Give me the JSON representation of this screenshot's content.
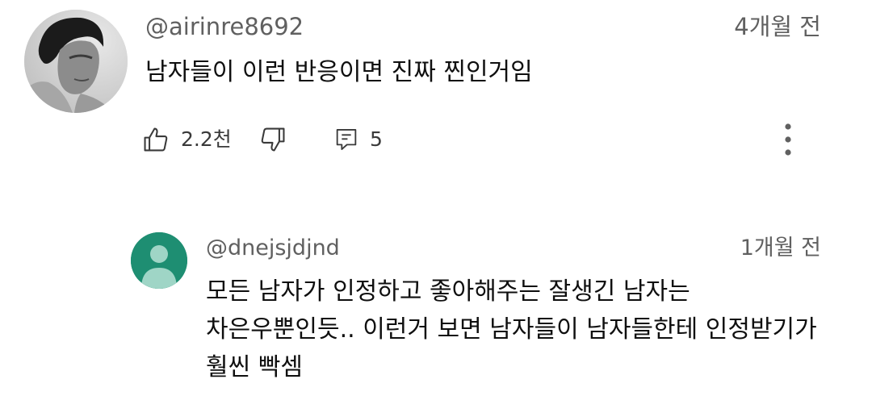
{
  "comment": {
    "author": "@airinre8692",
    "time": "4개월 전",
    "text": "남자들이 이런 반응이면 진짜 찐인거임",
    "like_count": "2.2천",
    "reply_count": "5",
    "icons": {
      "like": "thumbs-up-icon",
      "dislike": "thumbs-down-icon",
      "reply": "reply-icon",
      "more": "more-vertical-icon"
    }
  },
  "reply": {
    "author": "@dnejsjdjnd",
    "time": "1개월 전",
    "text": "모든 남자가 인정하고 좋아해주는 잘생긴 남자는 차은우뿐인듯.. 이런거 보면 남자들이 남자들한테 인정받기가 훨씬 빡셈",
    "avatar_color": "#1e8e72"
  }
}
